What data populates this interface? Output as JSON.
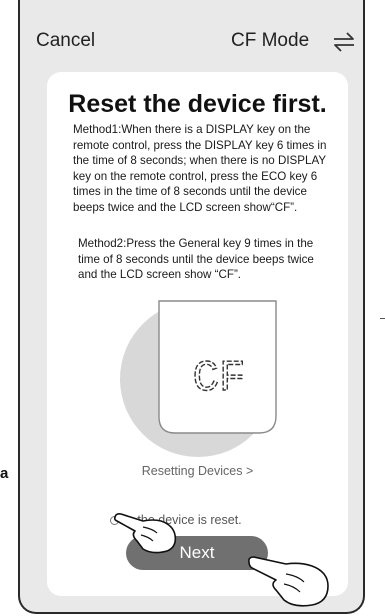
{
  "header": {
    "cancel_label": "Cancel",
    "mode_label": "CF Mode",
    "swap_icon": "swap-arrows-icon"
  },
  "card": {
    "title": "Reset the device first.",
    "method1": "Method1:When there is a DISPLAY key on the remote control, press the DISPLAY key 6 times in the time of 8 seconds; when there is no DISPLAY key on the remote control, press the ECO key 6 times in the time of 8 seconds until the device beeps twice and the LCD screen show“CF”.",
    "method2": "Method2:Press the General key 9 times in the time of 8 seconds until the device beeps twice and the LCD screen show “CF”.",
    "display_code": "CF",
    "resetting_link": "Resetting Devices >",
    "confirm_text": "n the device is reset.",
    "next_label": "Next"
  },
  "outside": {
    "letter": "a"
  },
  "colors": {
    "background": "#e9e9e9",
    "card": "#ffffff",
    "button": "#707070",
    "dial_ring": "#d8d8d8"
  }
}
